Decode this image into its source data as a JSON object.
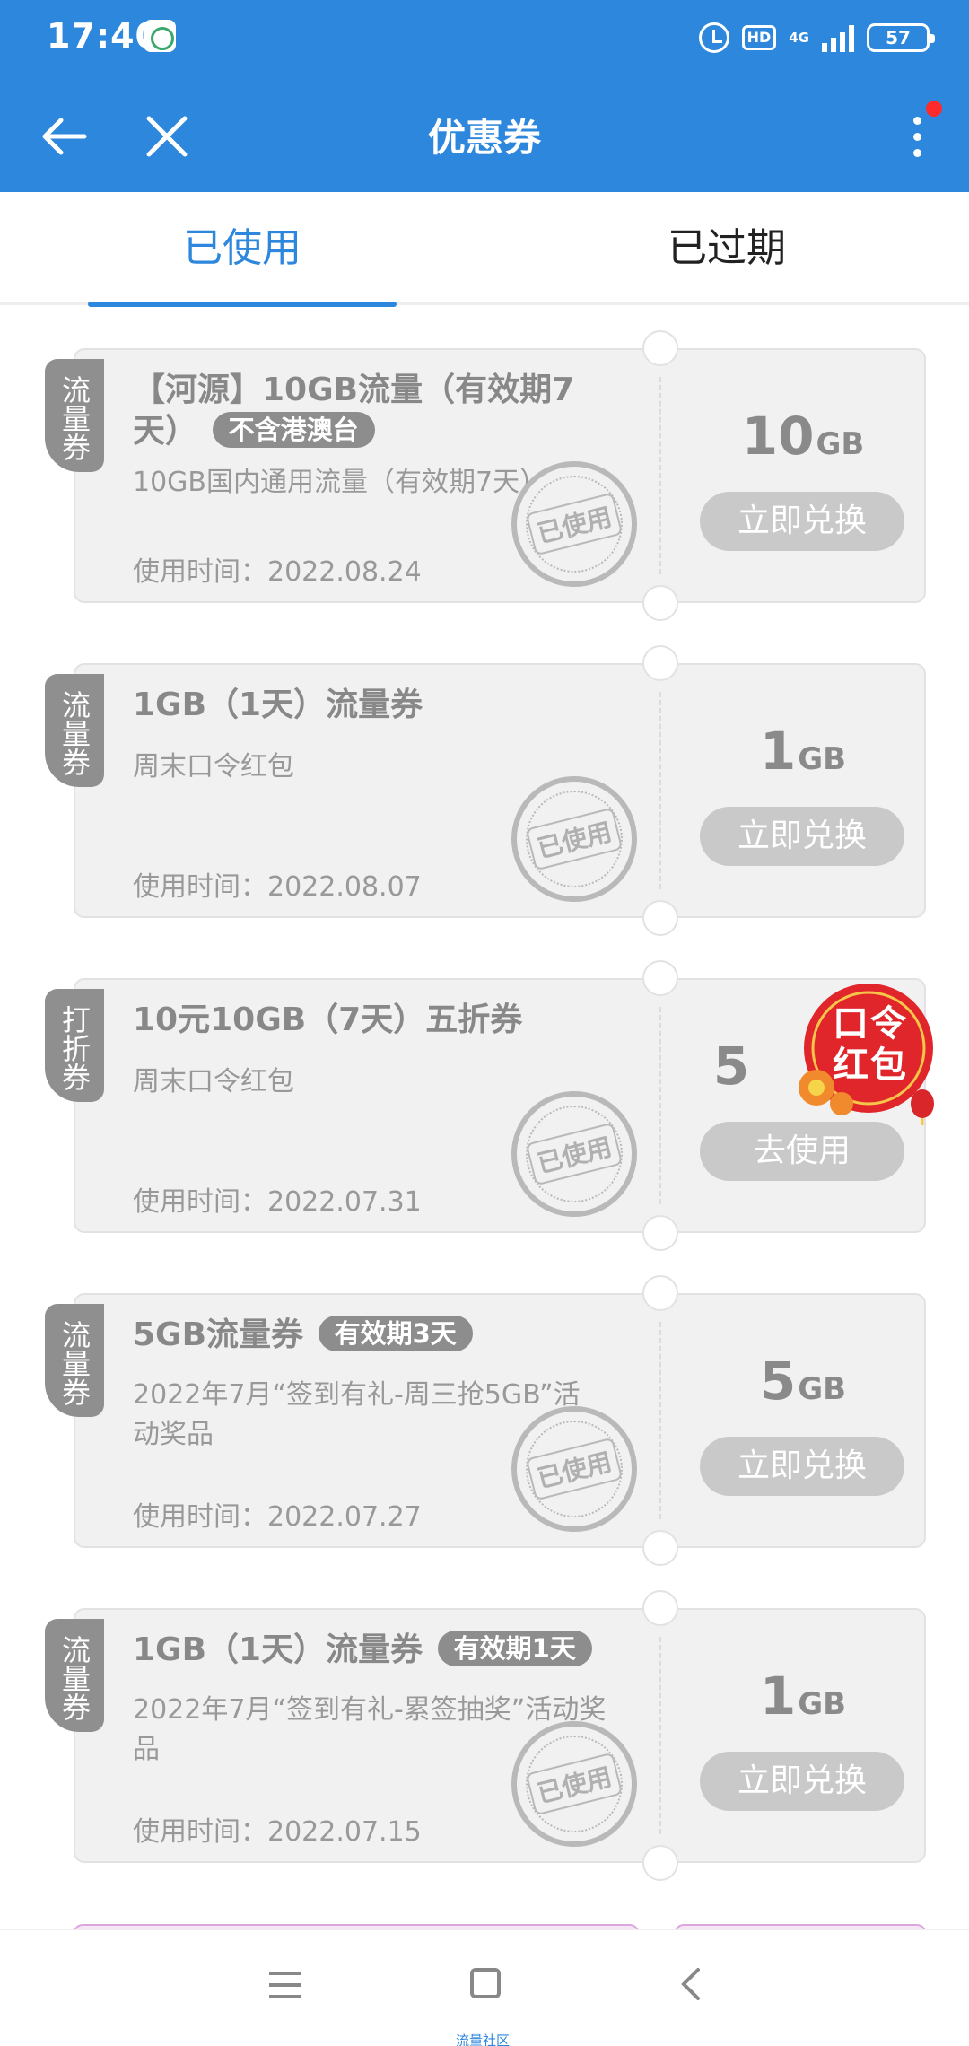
{
  "status_bar": {
    "time": "17:40",
    "hd": "HD",
    "network": "4G",
    "battery": "57"
  },
  "header": {
    "title": "优惠券"
  },
  "tabs": [
    {
      "label": "已使用"
    },
    {
      "label": "已过期"
    }
  ],
  "coupons": [
    {
      "tag": "流量券",
      "title": "【河源】10GB流量（有效期7天）",
      "badge": "不含港澳台",
      "desc": "10GB国内通用流量（有效期7天）",
      "time": "使用时间：2022.08.24",
      "amount": "10",
      "unit": "GB",
      "button": "立即兑换",
      "stamp": "已使用"
    },
    {
      "tag": "流量券",
      "title": "1GB（1天）流量券",
      "badge": "",
      "desc": "周末口令红包",
      "time": "使用时间：2022.08.07",
      "amount": "1",
      "unit": "GB",
      "button": "立即兑换",
      "stamp": "已使用"
    },
    {
      "tag": "打折券",
      "title": "10元10GB（7天）五折券",
      "badge": "",
      "desc": "周末口令红包",
      "time": "使用时间：2022.07.31",
      "amount": "5",
      "unit": "",
      "button": "去使用",
      "stamp": "已使用"
    },
    {
      "tag": "流量券",
      "title": "5GB流量券",
      "badge": "有效期3天",
      "desc": "2022年7月“签到有礼-周三抢5GB”活动奖品",
      "time": "使用时间：2022.07.27",
      "amount": "5",
      "unit": "GB",
      "button": "立即兑换",
      "stamp": "已使用"
    },
    {
      "tag": "流量券",
      "title": "1GB（1天）流量券",
      "badge": "有效期1天",
      "desc": "2022年7月“签到有礼-累签抽奖”活动奖品",
      "time": "使用时间：2022.07.15",
      "amount": "1",
      "unit": "GB",
      "button": "立即兑换",
      "stamp": "已使用"
    }
  ],
  "hongbao": {
    "text": "口令红包"
  },
  "navbar": {
    "caption": "流量社区"
  }
}
